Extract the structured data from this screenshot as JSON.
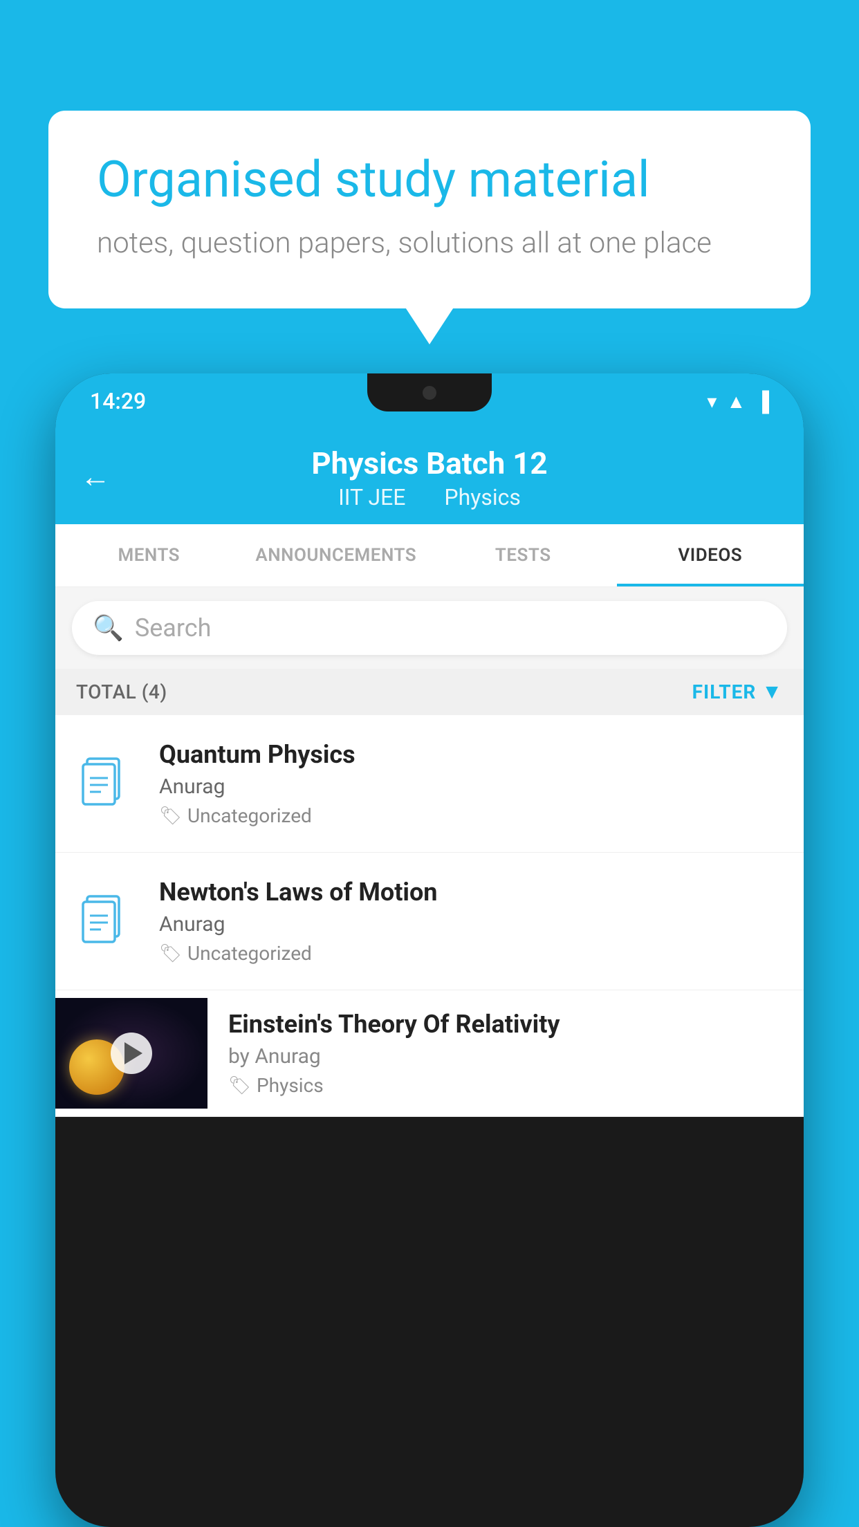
{
  "background": {
    "color": "#1ab8e8"
  },
  "speech_bubble": {
    "title": "Organised study material",
    "subtitle": "notes, question papers, solutions all at one place"
  },
  "phone": {
    "status_bar": {
      "time": "14:29"
    },
    "header": {
      "back_label": "←",
      "title": "Physics Batch 12",
      "subtitle_part1": "IIT JEE",
      "subtitle_part2": "Physics"
    },
    "tabs": [
      {
        "label": "MENTS",
        "active": false
      },
      {
        "label": "ANNOUNCEMENTS",
        "active": false
      },
      {
        "label": "TESTS",
        "active": false
      },
      {
        "label": "VIDEOS",
        "active": true
      }
    ],
    "search": {
      "placeholder": "Search"
    },
    "filter_row": {
      "total_label": "TOTAL (4)",
      "filter_label": "FILTER"
    },
    "video_items": [
      {
        "type": "file",
        "title": "Quantum Physics",
        "author": "Anurag",
        "tag": "Uncategorized"
      },
      {
        "type": "file",
        "title": "Newton's Laws of Motion",
        "author": "Anurag",
        "tag": "Uncategorized"
      },
      {
        "type": "thumb",
        "title": "Einstein's Theory Of Relativity",
        "author": "by Anurag",
        "tag": "Physics"
      }
    ]
  }
}
